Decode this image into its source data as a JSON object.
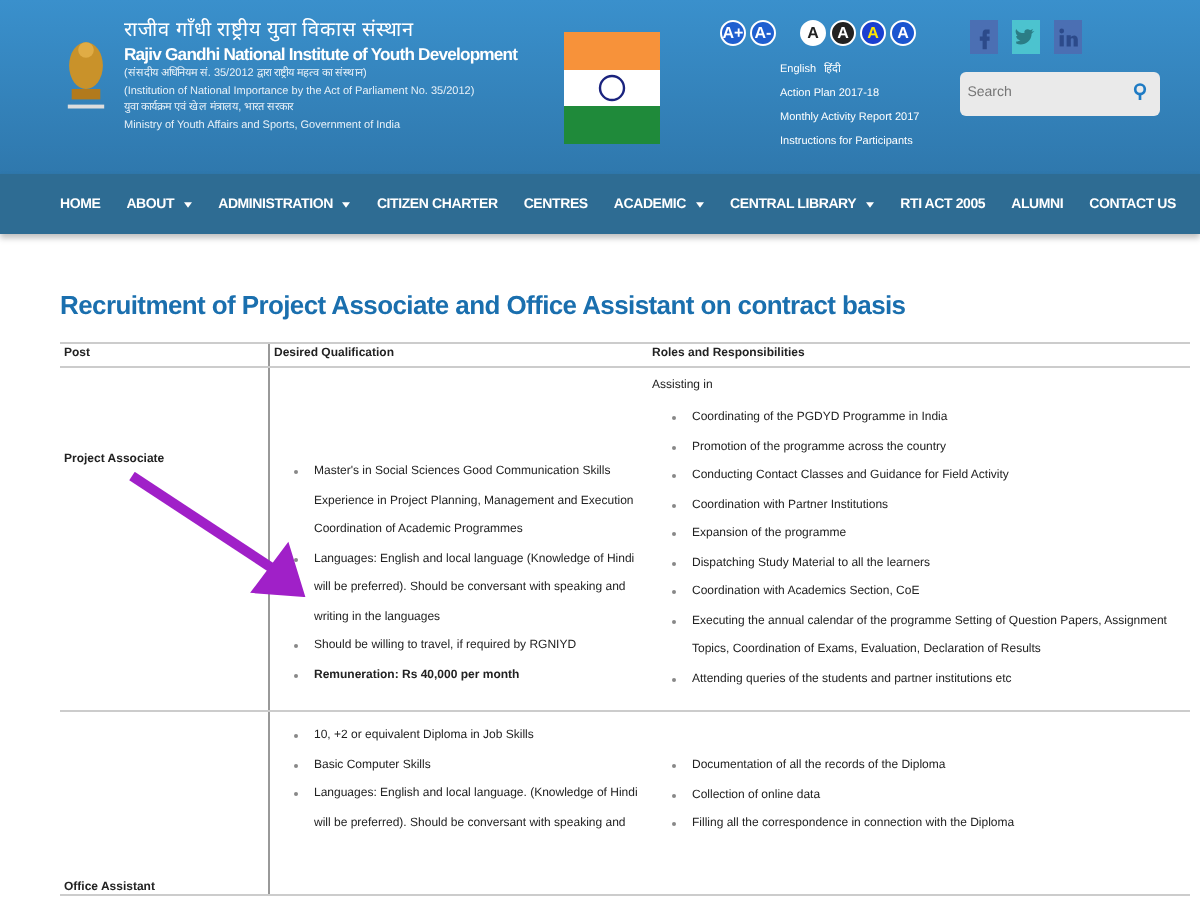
{
  "header": {
    "title_hindi": "राजीव गाँधी राष्ट्रीय युवा विकास संस्थान",
    "title": "Rajiv Gandhi National Institute of Youth Development",
    "lines": [
      "(संसदीय अधिनियम सं. 35/2012 द्वारा राष्ट्रीय महत्व का संस्थान)",
      "(Institution of National Importance by the Act of Parliament No. 35/2012)",
      "युवा कार्यक्रम एवं खेल मंत्रालय, भारत सरकार",
      "Ministry of Youth Affairs and Sports, Government of India"
    ],
    "font_buttons": [
      "A+",
      "A-"
    ],
    "contrast_buttons": [
      {
        "label": "A",
        "kind": "white"
      },
      {
        "label": "A",
        "kind": "black"
      },
      {
        "label": "A",
        "kind": "yellow"
      },
      {
        "label": "A",
        "kind": "blue"
      }
    ],
    "languages": [
      "English",
      "हिंदी"
    ],
    "links": [
      "Action Plan 2017-18",
      "Monthly Activity Report 2017",
      "Instructions for Participants"
    ],
    "social": [
      {
        "kind": "facebook"
      },
      {
        "kind": "twitter"
      },
      {
        "kind": "linkedin"
      }
    ],
    "search": {
      "placeholder": "Search"
    }
  },
  "nav": [
    {
      "label": "HOME",
      "dropdown": false
    },
    {
      "label": "ABOUT",
      "dropdown": true
    },
    {
      "label": "ADMINISTRATION",
      "dropdown": true
    },
    {
      "label": "CITIZEN CHARTER",
      "dropdown": false
    },
    {
      "label": "CENTRES",
      "dropdown": false
    },
    {
      "label": "ACADEMIC",
      "dropdown": true
    },
    {
      "label": "CENTRAL LIBRARY",
      "dropdown": true
    },
    {
      "label": "RTI ACT 2005",
      "dropdown": false
    },
    {
      "label": "ALUMNI",
      "dropdown": false
    },
    {
      "label": "CONTACT US",
      "dropdown": false
    }
  ],
  "page_title": "Recruitment of Project Associate and Office Assistant on contract basis",
  "table": {
    "columns": [
      "Post",
      "Desired Qualification",
      "Roles  and Responsibilities"
    ],
    "rows": [
      {
        "post": "Project Associate",
        "roles_intro": "Assisting in",
        "qualifications": [
          {
            "text": "Master's in Social Sciences Good Communication Skills Experience in Project Planning, Management and Execution Coordination of Academic Programmes",
            "bold": false
          },
          {
            "text": "Languages: English and local language (Knowledge of Hindi will be preferred). Should be conversant with speaking and writing in the languages",
            "bold": false
          },
          {
            "text": "Should be willing to travel, if required by RGNIYD",
            "bold": false
          },
          {
            "text": "Remuneration: Rs 40,000 per month",
            "bold": true
          }
        ],
        "roles": [
          "Coordinating of the PGDYD Programme in India",
          "Promotion of the programme across the country",
          "Conducting Contact Classes and Guidance for Field Activity",
          "Coordination with Partner Institutions",
          "Expansion of the programme",
          "Dispatching Study Material to all the learners",
          "Coordination with Academics Section, CoE",
          "Executing the annual calendar of the programme Setting of Question Papers, Assignment Topics, Coordination of Exams, Evaluation, Declaration of Results",
          "Attending queries of the students and partner institutions etc"
        ]
      },
      {
        "post": "Office Assistant",
        "qualifications": [
          {
            "text": "10, +2 or equivalent Diploma in Job Skills",
            "bold": false
          },
          {
            "text": "Basic Computer Skills",
            "bold": false
          },
          {
            "text": "Languages: English and local language. (Knowledge of Hindi will be preferred). Should be conversant with speaking and",
            "bold": false
          }
        ],
        "roles": [
          "Documentation of all the records of the Diploma",
          "Collection of online data",
          "Filling all the correspondence in connection with the Diploma"
        ]
      }
    ]
  }
}
